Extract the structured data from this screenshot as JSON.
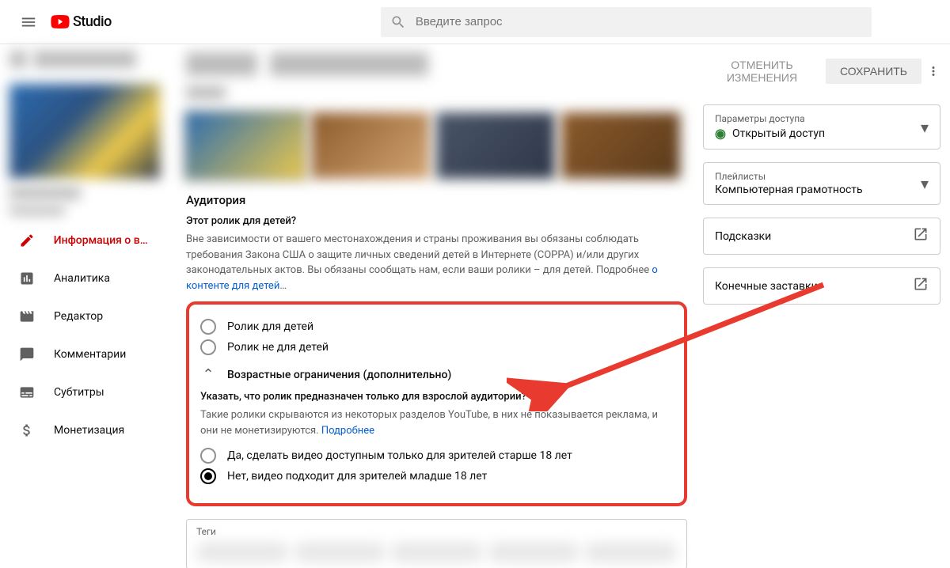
{
  "header": {
    "logo_text": "Studio",
    "search_placeholder": "Введите запрос"
  },
  "sidebar": {
    "items": [
      {
        "label": "Информация о ви…",
        "icon": "pencil"
      },
      {
        "label": "Аналитика",
        "icon": "analytics"
      },
      {
        "label": "Редактор",
        "icon": "editor"
      },
      {
        "label": "Комментарии",
        "icon": "comments"
      },
      {
        "label": "Субтитры",
        "icon": "subtitles"
      },
      {
        "label": "Монетизация",
        "icon": "dollar"
      }
    ]
  },
  "actions": {
    "cancel": "ОТМЕНИТЬ ИЗМЕНЕНИЯ",
    "save": "СОХРАНИТЬ"
  },
  "audience": {
    "heading": "Аудитория",
    "question": "Этот ролик для детей?",
    "description": "Вне зависимости от вашего местонахождения и страны проживания вы обязаны соблюдать требования Закона США о защите личных сведений детей в Интернете (COPPA) и/или других законодательных актов. Вы обязаны сообщать нам, если ваши ролики – для детей. Подробнее ",
    "description_link": "о контенте для детей",
    "radio1": "Ролик для детей",
    "radio2": "Ролик не для детей",
    "expander": "Возрастные ограничения (дополнительно)",
    "age_q": "Указать, что ролик предназначен только для взрослой аудитории?",
    "age_desc": "Такие ролики скрываются из некоторых разделов YouTube, в них не показывается реклама, и они не монетизируются. ",
    "age_link": "Подробнее",
    "age_radio1": "Да, сделать видео доступным только для зрителей старше 18 лет",
    "age_radio2": "Нет, видео подходит для зрителей младше 18 лет"
  },
  "right_panel": {
    "visibility_label": "Параметры доступа",
    "visibility_value": "Открытый доступ",
    "playlist_label": "Плейлисты",
    "playlist_value": "Компьютерная грамотность",
    "cards": "Подсказки",
    "endscreens": "Конечные заставки"
  },
  "tags": {
    "label": "Теги"
  }
}
